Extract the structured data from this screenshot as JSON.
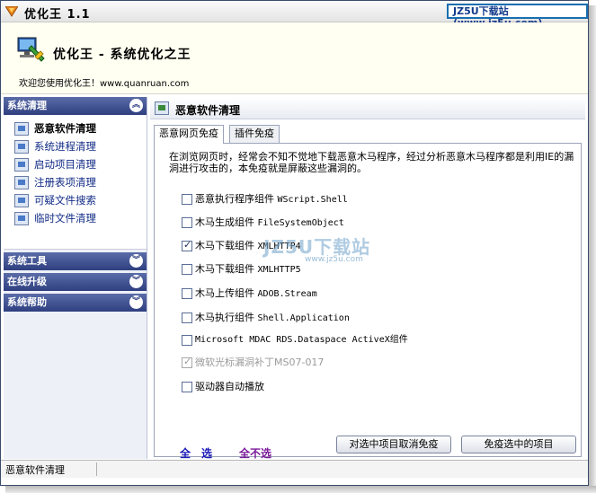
{
  "titlebar": {
    "title": "优化王 1.1",
    "watermark": "JZ5U下载站(www.jz5u.com)"
  },
  "header": {
    "title": "优化王 - 系统优化之王",
    "welcome": "欢迎您使用优化王！www.quanruan.com"
  },
  "sidebar": {
    "section_clean": "系统清理",
    "items": [
      {
        "label": "恶意软件清理",
        "icon": "malware-clean-icon"
      },
      {
        "label": "系统进程清理",
        "icon": "process-clean-icon"
      },
      {
        "label": "启动项目清理",
        "icon": "startup-clean-icon"
      },
      {
        "label": "注册表项清理",
        "icon": "registry-clean-icon"
      },
      {
        "label": "可疑文件搜索",
        "icon": "file-search-icon"
      },
      {
        "label": "临时文件清理",
        "icon": "temp-clean-icon"
      }
    ],
    "section_tools": "系统工具",
    "section_upgrade": "在线升级",
    "section_help": "系统帮助"
  },
  "content": {
    "title": "恶意软件清理",
    "tabs": [
      "恶意网页免疫",
      "插件免疫"
    ],
    "description": "在浏览网页时，经常会不知不觉地下载恶意木马程序，经过分析恶意木马程序都是利用IE的漏洞进行攻击的，本免疫就是屏蔽这些漏洞的。",
    "options": [
      {
        "label": "恶意执行程序组件",
        "code": "WScript.Shell",
        "checked": false
      },
      {
        "label": "木马生成组件",
        "code": "FileSystemObject",
        "checked": false
      },
      {
        "label": "木马下载组件",
        "code": "XMLHTTP4",
        "checked": true
      },
      {
        "label": "木马下载组件",
        "code": "XMLHTTP5",
        "checked": false
      },
      {
        "label": "木马上传组件",
        "code": "ADOB.Stream",
        "checked": false
      },
      {
        "label": "木马执行组件",
        "code": "Shell.Application",
        "checked": false
      },
      {
        "label": "Microsoft MDAC RDS.Dataspace ActiveX组件",
        "code": "",
        "checked": false
      },
      {
        "label": "微软光标漏洞补丁MS07-017",
        "code": "",
        "checked": true,
        "disabled": true
      },
      {
        "label": "驱动器自动播放",
        "code": "",
        "checked": false
      }
    ],
    "select_all": "全　选",
    "select_none": "全不选",
    "btn_cancel_immune": "对选中项目取消免疫",
    "btn_immune": "免疫选中的项目"
  },
  "overlay_watermark": {
    "big": "JZ5U下载站",
    "small": "www.jz5u.com"
  },
  "status": {
    "text": "恶意软件清理"
  }
}
